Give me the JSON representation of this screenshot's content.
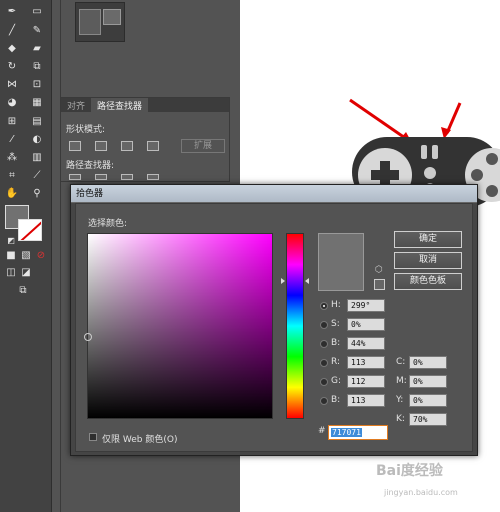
{
  "toolbar": {
    "tools": [
      "pen-tool-icon",
      "rectangle-tool-icon",
      "brush-tool-icon",
      "pencil-tool-icon",
      "blob-brush-icon",
      "eraser-icon",
      "rotate-icon",
      "scale-icon",
      "width-tool-icon",
      "free-transform-icon",
      "shape-builder-icon",
      "perspective-icon",
      "mesh-icon",
      "gradient-icon",
      "eyedropper-icon",
      "blend-icon",
      "symbol-sprayer-icon",
      "graph-icon",
      "artboard-icon",
      "slice-icon",
      "hand-icon",
      "zoom-icon"
    ]
  },
  "pathfinder": {
    "tabs": [
      "对齐",
      "路径查找器"
    ],
    "shape_modes_label": "形状模式:",
    "pathfinders_label": "路径查找器:",
    "expand_label": "扩展"
  },
  "picker": {
    "title": "拾色器",
    "select_label": "选择颜色:",
    "ok_label": "确定",
    "cancel_label": "取消",
    "swatches_label": "颜色色板",
    "only_web_label": "仅限 Web 颜色(O)",
    "fields": {
      "H": {
        "label": "H:",
        "value": "299°"
      },
      "S": {
        "label": "S:",
        "value": "0%"
      },
      "B": {
        "label": "B:",
        "value": "44%"
      },
      "R": {
        "label": "R:",
        "value": "113"
      },
      "G": {
        "label": "G:",
        "value": "112"
      },
      "Bl": {
        "label": "B:",
        "value": "113"
      },
      "C": {
        "label": "C:",
        "value": "0%"
      },
      "M": {
        "label": "M:",
        "value": "0%"
      },
      "Y": {
        "label": "Y:",
        "value": "0%"
      },
      "K": {
        "label": "K:",
        "value": "70%"
      }
    },
    "hex_prefix": "#",
    "hex_value": "717071"
  },
  "watermark": {
    "brand": "Bai度经验",
    "url": "jingyan.baidu.com"
  },
  "colors": {
    "current_color": "#717171",
    "annotation_arrow": "#e00000",
    "artboard": "#ffffff"
  }
}
